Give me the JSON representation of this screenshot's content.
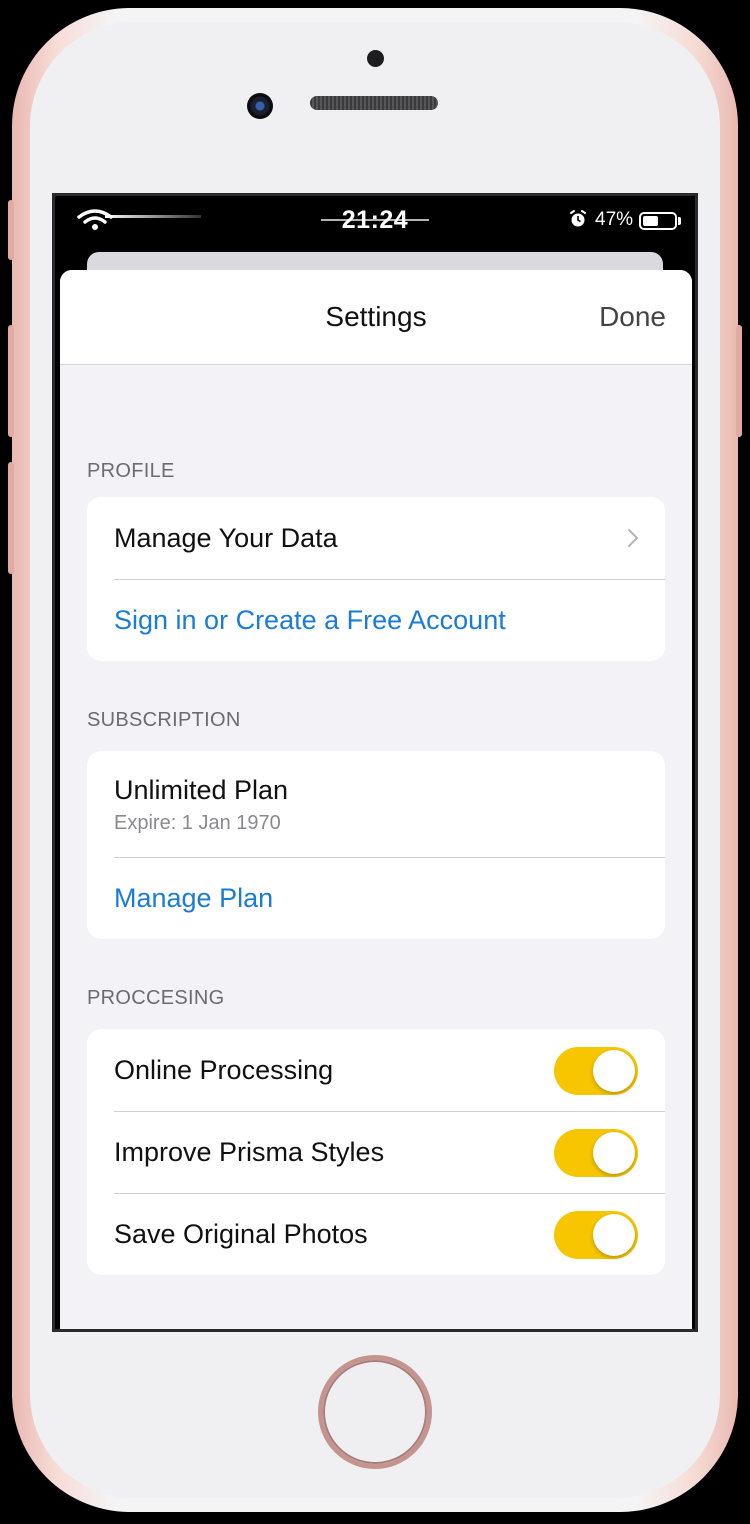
{
  "status_bar": {
    "time": "21:24",
    "battery": "47%",
    "icons": [
      "wifi-icon",
      "alarm-icon",
      "battery-icon"
    ]
  },
  "nav": {
    "title": "Settings",
    "done_label": "Done"
  },
  "profile": {
    "header": "PROFILE",
    "manage_data": "Manage Your Data",
    "sign_in": "Sign in or Create a Free Account"
  },
  "subscription": {
    "header": "SUBSCRIPTION",
    "plan_name": "Unlimited Plan",
    "plan_expire": "Expire: 1 Jan 1970",
    "manage_plan": "Manage Plan"
  },
  "processing": {
    "header": "PROCCESING",
    "items": [
      {
        "label": "Online Processing",
        "on": true
      },
      {
        "label": "Improve Prisma Styles",
        "on": true
      },
      {
        "label": "Save Original Photos",
        "on": true
      }
    ]
  },
  "colors": {
    "accent_link": "#1a7cd8",
    "toggle_on": "#f7c600",
    "background": "#f2f2f7"
  }
}
